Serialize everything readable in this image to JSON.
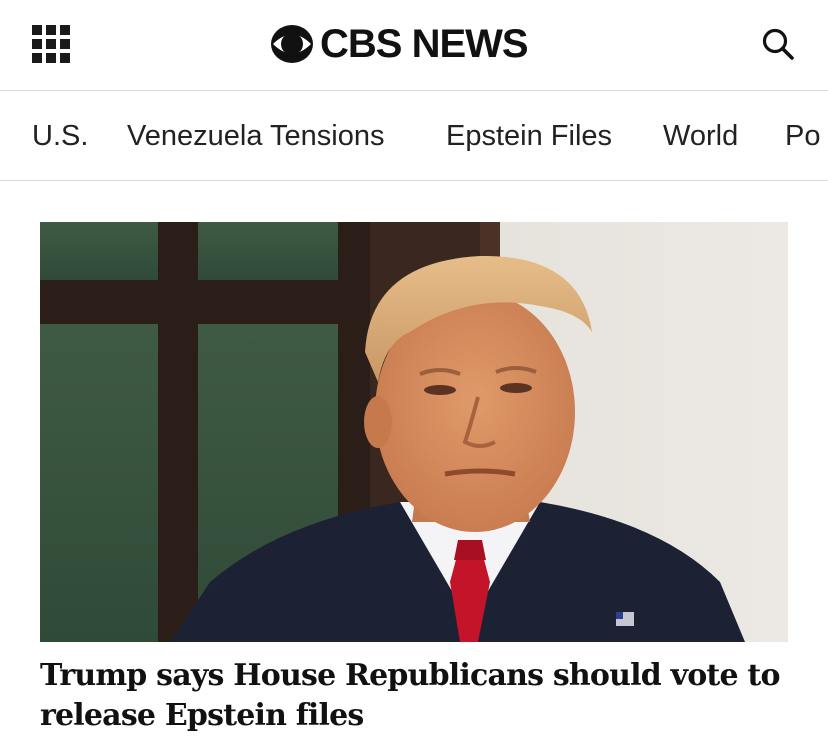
{
  "header": {
    "logo_text": "CBS NEWS",
    "menu_icon": "grid-menu-icon",
    "search_icon": "search-icon"
  },
  "nav": {
    "items": [
      {
        "label": "U.S."
      },
      {
        "label": "Venezuela Tensions"
      },
      {
        "label": "Epstein Files"
      },
      {
        "label": "World"
      },
      {
        "label": "Po"
      }
    ]
  },
  "article": {
    "headline": "Trump says House Republicans should vote to release Epstein files"
  },
  "colors": {
    "text": "#111111",
    "divider": "#d9d9d9",
    "background": "#ffffff"
  }
}
